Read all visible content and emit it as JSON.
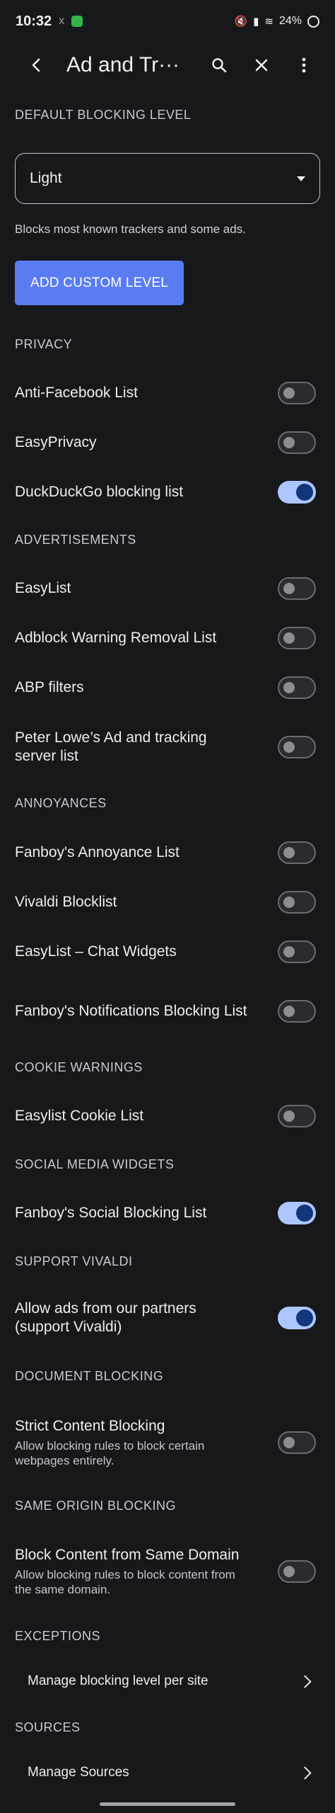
{
  "status_bar": {
    "time": "10:32",
    "notification": "X",
    "battery": "24%"
  },
  "toolbar": {
    "title": "Ad and Tr···"
  },
  "default_level": {
    "header": "DEFAULT BLOCKING LEVEL",
    "selected": "Light",
    "helper": "Blocks most known trackers and some ads.",
    "add_button": "ADD CUSTOM LEVEL"
  },
  "sections": {
    "privacy": "PRIVACY",
    "advertisements": "ADVERTISEMENTS",
    "annoyances": "ANNOYANCES",
    "cookie_warnings": "COOKIE WARNINGS",
    "social_media": "SOCIAL MEDIA WIDGETS",
    "support": "SUPPORT VIVALDI",
    "document_blocking": "DOCUMENT BLOCKING",
    "same_origin": "SAME ORIGIN BLOCKING",
    "exceptions": "EXCEPTIONS",
    "sources": "SOURCES"
  },
  "lists": {
    "anti_facebook": {
      "label": "Anti-Facebook List",
      "enabled": false
    },
    "easyprivacy": {
      "label": "EasyPrivacy",
      "enabled": false
    },
    "duckduckgo": {
      "label": "DuckDuckGo blocking list",
      "enabled": true
    },
    "easylist": {
      "label": "EasyList",
      "enabled": false
    },
    "adblock_warning": {
      "label": "Adblock Warning Removal List",
      "enabled": false
    },
    "abp_filters": {
      "label": "ABP filters",
      "enabled": false
    },
    "peter_lowe": {
      "label": "Peter Lowe’s Ad and tracking server list",
      "enabled": false
    },
    "fanboy_annoyance": {
      "label": "Fanboy's Annoyance List",
      "enabled": false
    },
    "vivaldi_blocklist": {
      "label": "Vivaldi Blocklist",
      "enabled": false
    },
    "easylist_chat": {
      "label": "EasyList – Chat Widgets",
      "enabled": false
    },
    "fanboy_notifications": {
      "label": "Fanboy's Notifications Blocking List",
      "enabled": false
    },
    "easylist_cookie": {
      "label": "Easylist Cookie List",
      "enabled": false
    },
    "fanboy_social": {
      "label": "Fanboy's Social Blocking List",
      "enabled": true
    },
    "partner_ads": {
      "label": "Allow ads from our partners (support Vivaldi)",
      "enabled": true
    },
    "strict_content": {
      "label": "Strict Content Blocking",
      "description": "Allow blocking rules to block certain webpages entirely.",
      "enabled": false
    },
    "same_domain": {
      "label": "Block Content from Same Domain",
      "description": "Allow blocking rules to block content from the same domain.",
      "enabled": false
    }
  },
  "navigation": {
    "manage_per_site": "Manage blocking level per site",
    "manage_sources": "Manage Sources"
  },
  "colors": {
    "background": "#17181a",
    "accent": "#5a7cf2",
    "switch_on_track": "#adc6ff",
    "switch_on_knob": "#13357c"
  },
  "icons": {
    "back": "arrow-left-icon",
    "search": "search-icon",
    "close": "close-icon",
    "more": "more-vertical-icon",
    "dropdown": "triangle-down-icon",
    "chevron": "chevron-right-icon"
  }
}
